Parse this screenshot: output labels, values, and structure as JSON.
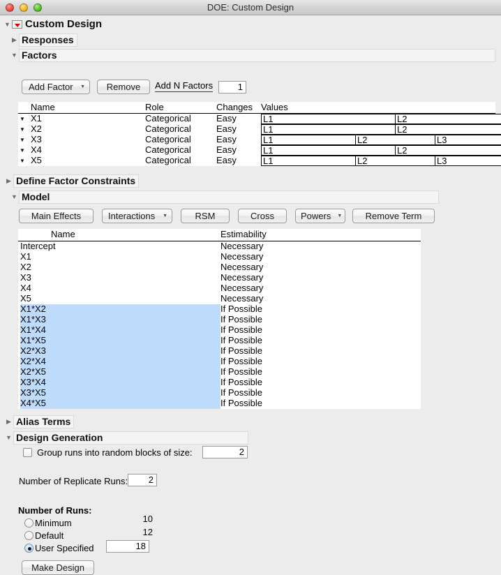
{
  "window": {
    "title": "DOE: Custom Design",
    "traffic_lights": [
      "close-light",
      "minimize-light",
      "zoom-light"
    ]
  },
  "outline": {
    "root_label": "Custom Design",
    "responses_label": "Responses",
    "factors_label": "Factors",
    "define_factor_constraints_label": "Define Factor Constraints",
    "model_label": "Model",
    "alias_terms_label": "Alias Terms",
    "design_generation_label": "Design Generation"
  },
  "factors_toolbar": {
    "add_factor_label": "Add Factor",
    "remove_label": "Remove",
    "add_n_factors_label": "Add N Factors",
    "add_n_factors_value": "1"
  },
  "factors_table": {
    "columns": [
      "Name",
      "Role",
      "Changes",
      "Values"
    ],
    "rows": [
      {
        "name": "X1",
        "role": "Categorical",
        "changes": "Easy",
        "values": [
          "L1",
          "L2"
        ]
      },
      {
        "name": "X2",
        "role": "Categorical",
        "changes": "Easy",
        "values": [
          "L1",
          "L2"
        ]
      },
      {
        "name": "X3",
        "role": "Categorical",
        "changes": "Easy",
        "values": [
          "L1",
          "L2",
          "L3"
        ]
      },
      {
        "name": "X4",
        "role": "Categorical",
        "changes": "Easy",
        "values": [
          "L1",
          "L2"
        ]
      },
      {
        "name": "X5",
        "role": "Categorical",
        "changes": "Easy",
        "values": [
          "L1",
          "L2",
          "L3"
        ]
      }
    ]
  },
  "model_toolbar": {
    "main_effects_label": "Main Effects",
    "interactions_label": "Interactions",
    "rsm_label": "RSM",
    "cross_label": "Cross",
    "powers_label": "Powers",
    "remove_term_label": "Remove Term"
  },
  "model_table": {
    "columns": [
      "Name",
      "Estimability"
    ],
    "rows": [
      {
        "name": "Intercept",
        "estimability": "Necessary",
        "selected": false
      },
      {
        "name": "X1",
        "estimability": "Necessary",
        "selected": false
      },
      {
        "name": "X2",
        "estimability": "Necessary",
        "selected": false
      },
      {
        "name": "X3",
        "estimability": "Necessary",
        "selected": false
      },
      {
        "name": "X4",
        "estimability": "Necessary",
        "selected": false
      },
      {
        "name": "X5",
        "estimability": "Necessary",
        "selected": false
      },
      {
        "name": "X1*X2",
        "estimability": "If Possible",
        "selected": true
      },
      {
        "name": "X1*X3",
        "estimability": "If Possible",
        "selected": true
      },
      {
        "name": "X1*X4",
        "estimability": "If Possible",
        "selected": true
      },
      {
        "name": "X1*X5",
        "estimability": "If Possible",
        "selected": true
      },
      {
        "name": "X2*X3",
        "estimability": "If Possible",
        "selected": true
      },
      {
        "name": "X2*X4",
        "estimability": "If Possible",
        "selected": true
      },
      {
        "name": "X2*X5",
        "estimability": "If Possible",
        "selected": true
      },
      {
        "name": "X3*X4",
        "estimability": "If Possible",
        "selected": true
      },
      {
        "name": "X3*X5",
        "estimability": "If Possible",
        "selected": true
      },
      {
        "name": "X4*X5",
        "estimability": "If Possible",
        "selected": true
      }
    ]
  },
  "design_generation": {
    "group_runs_label": "Group runs into random blocks of size:",
    "group_runs_checked": false,
    "block_size_value": "2",
    "replicate_runs_label": "Number of Replicate Runs:",
    "replicate_runs_value": "2",
    "number_of_runs_label": "Number of Runs:",
    "minimum_label": "Minimum",
    "minimum_value": "10",
    "default_label": "Default",
    "default_value": "12",
    "user_specified_label": "User Specified",
    "user_specified_value": "18",
    "selected_run_option": "User Specified",
    "make_design_label": "Make Design"
  },
  "colors": {
    "selection_highlight": "#bfdbfb",
    "red_triangle": "#d00000",
    "window_chrome": "#ececec",
    "section_header_bg": "#f4f4f4"
  }
}
